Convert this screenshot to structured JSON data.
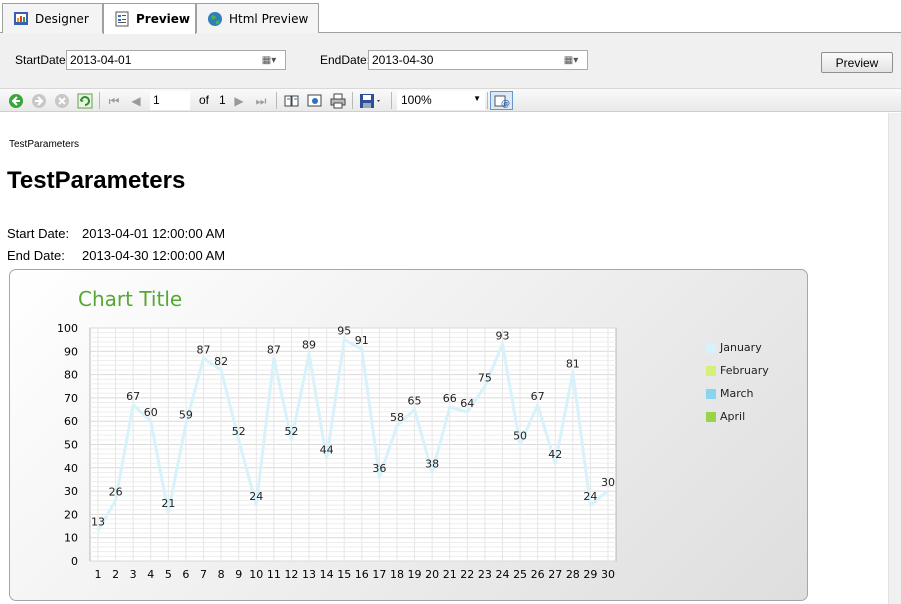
{
  "tabs": [
    {
      "label": "Designer",
      "icon": "designer-icon"
    },
    {
      "label": "Preview",
      "icon": "preview-icon"
    },
    {
      "label": "Html Preview",
      "icon": "globe-icon"
    }
  ],
  "params": {
    "start_label": "StartDate:",
    "start_value": "2013-04-01",
    "end_label": "EndDate:",
    "end_value": "2013-04-30",
    "preview_button": "Preview"
  },
  "toolbar": {
    "page_value": "1",
    "of_label": "of",
    "page_total": "1",
    "zoom_value": "100%"
  },
  "report": {
    "header_small": "TestParameters",
    "title": "TestParameters",
    "start_label": "Start Date:",
    "start_value": "2013-04-01 12:00:00 AM",
    "end_label": "End Date:",
    "end_value": "2013-04-30 12:00:00 AM"
  },
  "colors": {
    "title_green": "#55a832",
    "line": "#d8f2fb"
  },
  "chart_data": {
    "type": "line",
    "title": "Chart Title",
    "x": [
      1,
      2,
      3,
      4,
      5,
      6,
      7,
      8,
      9,
      10,
      11,
      12,
      13,
      14,
      15,
      16,
      17,
      18,
      19,
      20,
      21,
      22,
      23,
      24,
      25,
      26,
      27,
      28,
      29,
      30
    ],
    "series": [
      {
        "name": "January",
        "color": "#d8f2fb",
        "values": [
          13,
          26,
          67,
          60,
          21,
          59,
          87,
          82,
          52,
          24,
          87,
          52,
          89,
          44,
          95,
          91,
          36,
          58,
          65,
          38,
          66,
          64,
          75,
          93,
          50,
          67,
          42,
          81,
          24,
          30
        ]
      }
    ],
    "legend": [
      {
        "name": "January",
        "color": "#d8f2fb"
      },
      {
        "name": "February",
        "color": "#d4f07a"
      },
      {
        "name": "March",
        "color": "#8ad4ef"
      },
      {
        "name": "April",
        "color": "#98d44a"
      }
    ],
    "ylim": [
      0,
      100
    ],
    "yticks": [
      0,
      10,
      20,
      30,
      40,
      50,
      60,
      70,
      80,
      90,
      100
    ],
    "grid": true,
    "legend_position": "right"
  }
}
